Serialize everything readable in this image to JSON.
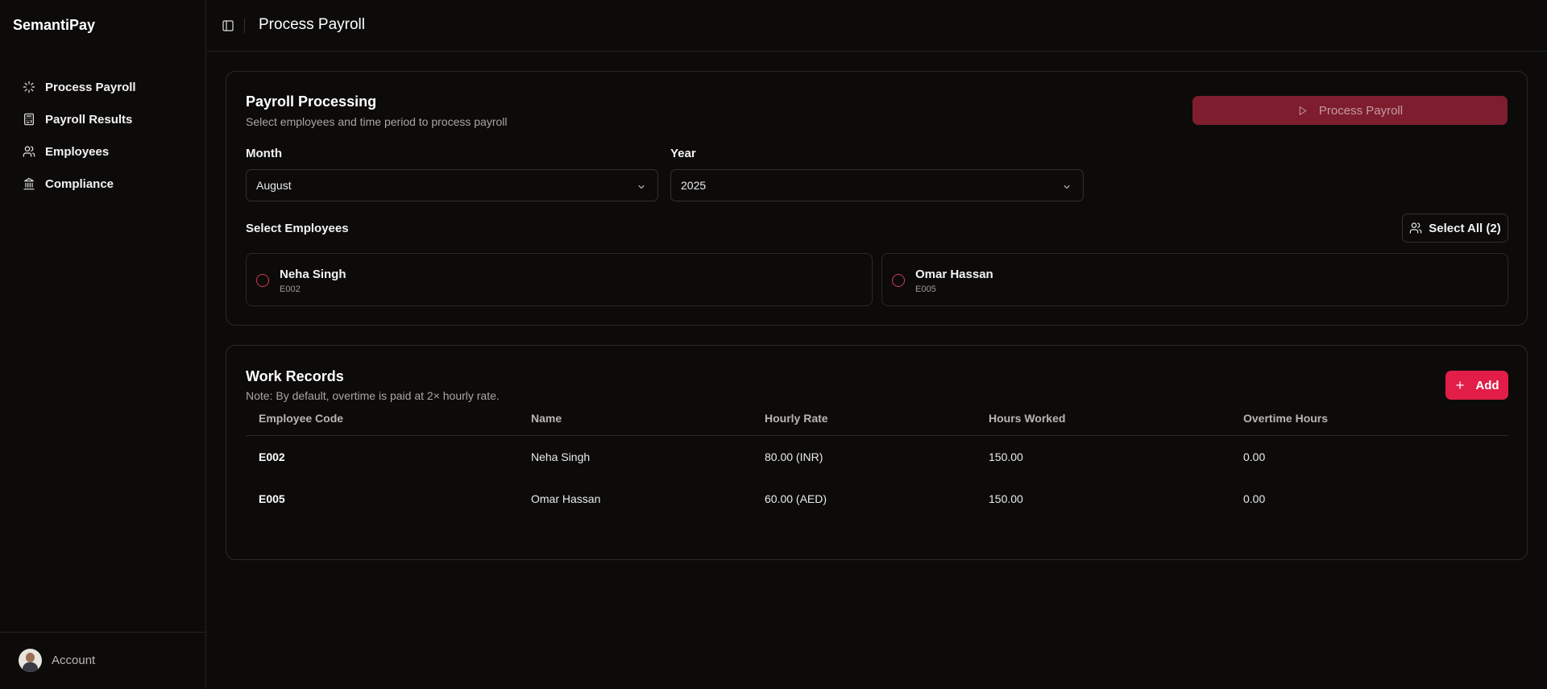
{
  "app": {
    "brand": "SemantiPay"
  },
  "sidebar": {
    "items": [
      {
        "label": "Process Payroll",
        "icon": "loader-icon"
      },
      {
        "label": "Payroll Results",
        "icon": "calculator-icon"
      },
      {
        "label": "Employees",
        "icon": "users-icon"
      },
      {
        "label": "Compliance",
        "icon": "landmark-icon"
      }
    ],
    "account_label": "Account"
  },
  "header": {
    "title": "Process Payroll"
  },
  "processing": {
    "title": "Payroll Processing",
    "subtitle": "Select employees and time period to process payroll",
    "process_button": "Process Payroll",
    "month_label": "Month",
    "month_value": "August",
    "year_label": "Year",
    "year_value": "2025",
    "select_employees_label": "Select Employees",
    "select_all_button": "Select All (2)",
    "employees": [
      {
        "name": "Neha Singh",
        "code": "E002"
      },
      {
        "name": "Omar Hassan",
        "code": "E005"
      }
    ]
  },
  "work_records": {
    "title": "Work Records",
    "note": "Note: By default, overtime is paid at 2× hourly rate.",
    "add_button": "Add",
    "columns": [
      "Employee Code",
      "Name",
      "Hourly Rate",
      "Hours Worked",
      "Overtime Hours"
    ],
    "rows": [
      [
        "E002",
        "Neha Singh",
        "80.00 (INR)",
        "150.00",
        "0.00"
      ],
      [
        "E005",
        "Omar Hassan",
        "60.00 (AED)",
        "150.00",
        "0.00"
      ]
    ]
  },
  "colors": {
    "accent": "#e11d48",
    "accent_disabled": "#7d1d2e",
    "background": "#0c0b0a",
    "border": "#2b2926"
  }
}
